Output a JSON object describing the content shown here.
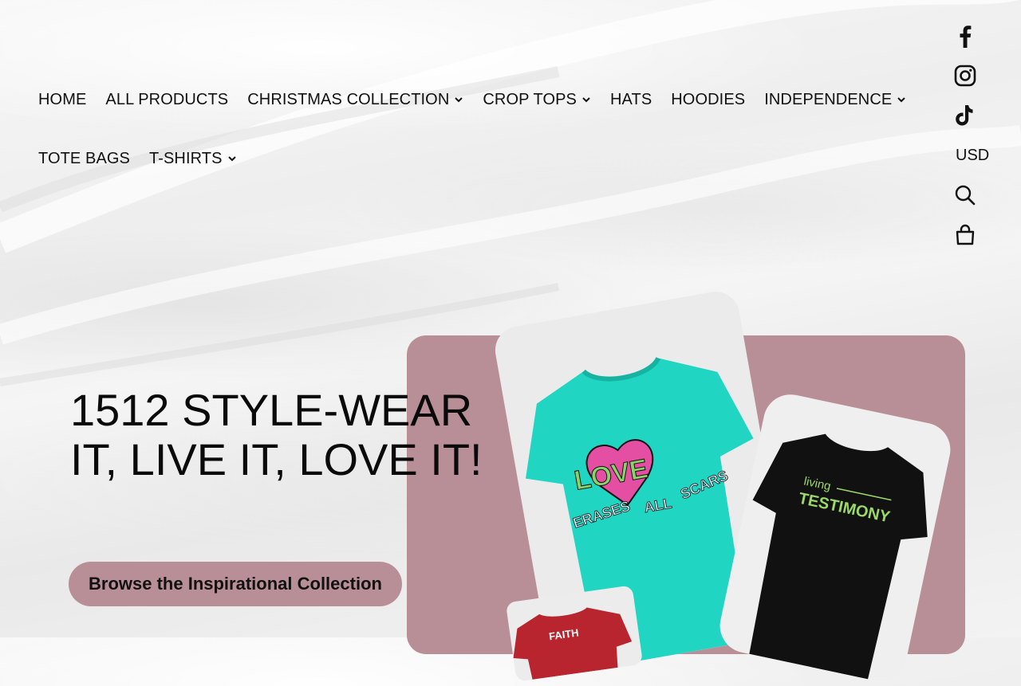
{
  "nav": {
    "row1": [
      {
        "label": "HOME",
        "dropdown": false
      },
      {
        "label": "ALL PRODUCTS",
        "dropdown": false
      },
      {
        "label": "CHRISTMAS COLLECTION",
        "dropdown": true
      },
      {
        "label": "CROP TOPS",
        "dropdown": true
      },
      {
        "label": "HATS",
        "dropdown": false
      },
      {
        "label": "HOODIES",
        "dropdown": false
      },
      {
        "label": "INDEPENDENCE",
        "dropdown": true
      }
    ],
    "row2": [
      {
        "label": "TOTE BAGS",
        "dropdown": false
      },
      {
        "label": "T-SHIRTS",
        "dropdown": true
      }
    ]
  },
  "header_icons": {
    "social": [
      "facebook-icon",
      "instagram-icon",
      "tiktok-icon"
    ],
    "currency": "USD",
    "actions": [
      "search-icon",
      "cart-icon"
    ]
  },
  "hero": {
    "title": "1512 STYLE-WEAR IT, LIVE IT, LOVE IT!",
    "cta_label": "Browse the Inspirational Collection",
    "accent_color": "#b98f97"
  },
  "products": {
    "shirt1": {
      "color": "#20d6c2",
      "text_love": "LOVE",
      "text_erases": "ERASES",
      "text_all": "ALL",
      "text_scars": "SCARS"
    },
    "shirt2": {
      "color": "#111111",
      "text_small": "living",
      "text_big": "TESTIMONY",
      "text_color": "#9bd86a"
    },
    "shirt3": {
      "color": "#b8252f",
      "text": "FAITH"
    }
  }
}
